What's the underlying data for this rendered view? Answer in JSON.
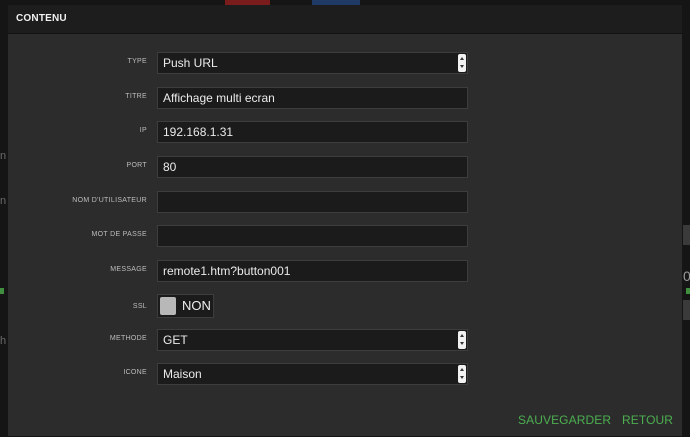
{
  "dialog": {
    "title": "CONTENU"
  },
  "form": {
    "type": {
      "label": "TYPE",
      "value": "Push URL"
    },
    "titre": {
      "label": "TITRE",
      "value": "Affichage multi ecran"
    },
    "ip": {
      "label": "IP",
      "value": "192.168.1.31"
    },
    "port": {
      "label": "PORT",
      "value": "80"
    },
    "username": {
      "label": "NOM D'UTILISATEUR",
      "value": ""
    },
    "password": {
      "label": "MOT DE PASSE",
      "value": ""
    },
    "message": {
      "label": "MESSAGE",
      "value": "remote1.htm?button001"
    },
    "ssl": {
      "label": "SSL",
      "state": "NON"
    },
    "methode": {
      "label": "METHODE",
      "value": "GET"
    },
    "icone": {
      "label": "ICONE",
      "value": "Maison"
    }
  },
  "footer": {
    "save_label": "SAUVEGARDER",
    "back_label": "RETOUR"
  },
  "background": {
    "left_letters": [
      "n",
      "n",
      "h"
    ],
    "right_letters": [
      "0"
    ]
  },
  "colors": {
    "accent": "#4caf50",
    "dialog_bg": "#2c2c2c",
    "header_bg": "#1d1d1d",
    "field_bg": "#1b1b1b"
  }
}
